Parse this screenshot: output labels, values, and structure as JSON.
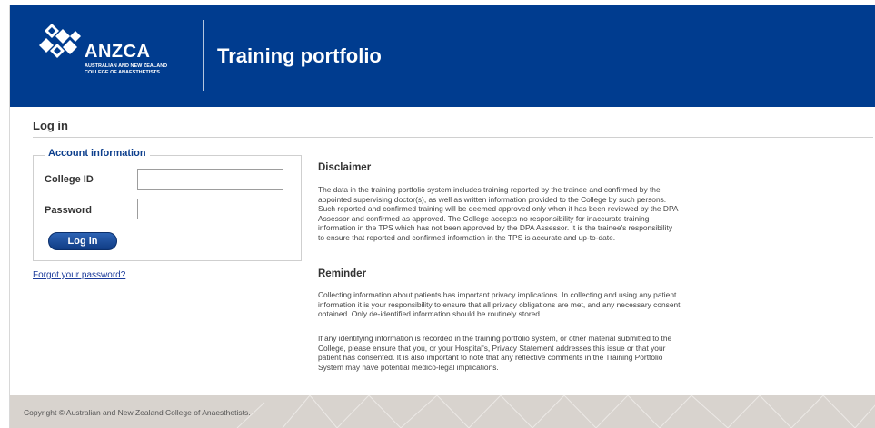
{
  "header": {
    "logo_word": "ANZCA",
    "logo_subtitle_line1": "AUSTRALIAN AND NEW ZEALAND",
    "logo_subtitle_line2": "COLLEGE OF ANAESTHETISTS",
    "title": "Training portfolio",
    "background_color": "#003c8f"
  },
  "page": {
    "heading": "Log in"
  },
  "login_form": {
    "legend": "Account information",
    "college_id_label": "College ID",
    "college_id_value": "",
    "password_label": "Password",
    "password_value": "",
    "submit_label": "Log in",
    "forgot_password_link": "Forgot your password?"
  },
  "disclaimer": {
    "title": "Disclaimer",
    "lines": [
      "The data in the training portfolio system includes training reported by the trainee and confirmed by the",
      "appointed supervising doctor(s), as well as written information provided to the College by such persons.",
      "Such reported and confirmed training will be deemed approved only when it has been reviewed by the DPA",
      "Assessor and confirmed as approved. The College accepts no responsibility for inaccurate training",
      "information in the TPS which has not been approved by the DPA Assessor. It is the trainee's responsibility",
      "to ensure that reported and confirmed information in the TPS is accurate and up-to-date."
    ]
  },
  "reminder": {
    "title": "Reminder",
    "paragraph1_lines": [
      "Collecting information about patients has important privacy implications. In collecting and using any patient",
      "information it is your responsibility to ensure that all privacy obligations are met, and any necessary consent",
      "obtained. Only de-identified information should be routinely stored."
    ],
    "paragraph2_lines": [
      "If any identifying information is recorded in the training portfolio system, or other material submitted to the",
      "College, please ensure that you, or your Hospital's, Privacy Statement addresses this issue or that your",
      "patient has consented. It is also important to note that any reflective comments in the Training Portfolio",
      "System may have potential medico-legal implications."
    ]
  },
  "footer": {
    "copyright": "Copyright © Australian and New Zealand College of Anaesthetists."
  }
}
